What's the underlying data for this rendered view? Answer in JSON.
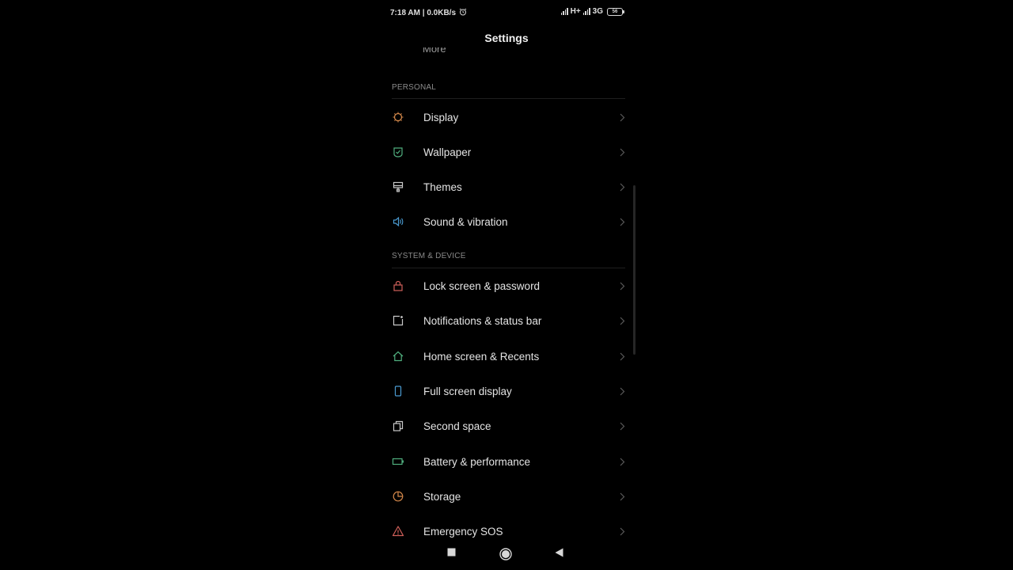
{
  "status_bar": {
    "time_speed": "7:18 AM | 0.0KB/s",
    "network1": "H+",
    "network2": "3G",
    "battery": "56"
  },
  "header": {
    "title": "Settings"
  },
  "clipped_item_label": "More",
  "sections": {
    "personal": "PERSONAL",
    "system": "SYSTEM & DEVICE"
  },
  "items": [
    {
      "label": "Display",
      "icon": "display-icon",
      "color": "#d4884a"
    },
    {
      "label": "Wallpaper",
      "icon": "wallpaper-icon",
      "color": "#4fae7e"
    },
    {
      "label": "Themes",
      "icon": "themes-icon",
      "color": "#c9c9c9"
    },
    {
      "label": "Sound & vibration",
      "icon": "sound-icon",
      "color": "#4a9ad0"
    },
    {
      "label": "Lock screen & password",
      "icon": "lock-icon",
      "color": "#d0605a"
    },
    {
      "label": "Notifications & status bar",
      "icon": "notifications-icon",
      "color": "#c9c9c9"
    },
    {
      "label": "Home screen & Recents",
      "icon": "home-icon",
      "color": "#4fae7e"
    },
    {
      "label": "Full screen display",
      "icon": "phone-icon",
      "color": "#4a9ad0"
    },
    {
      "label": "Second space",
      "icon": "second-space-icon",
      "color": "#c9c9c9"
    },
    {
      "label": "Battery & performance",
      "icon": "battery-icon",
      "color": "#4fae7e"
    },
    {
      "label": "Storage",
      "icon": "storage-icon",
      "color": "#d4884a"
    },
    {
      "label": "Emergency SOS",
      "icon": "emergency-icon",
      "color": "#d0605a"
    }
  ]
}
